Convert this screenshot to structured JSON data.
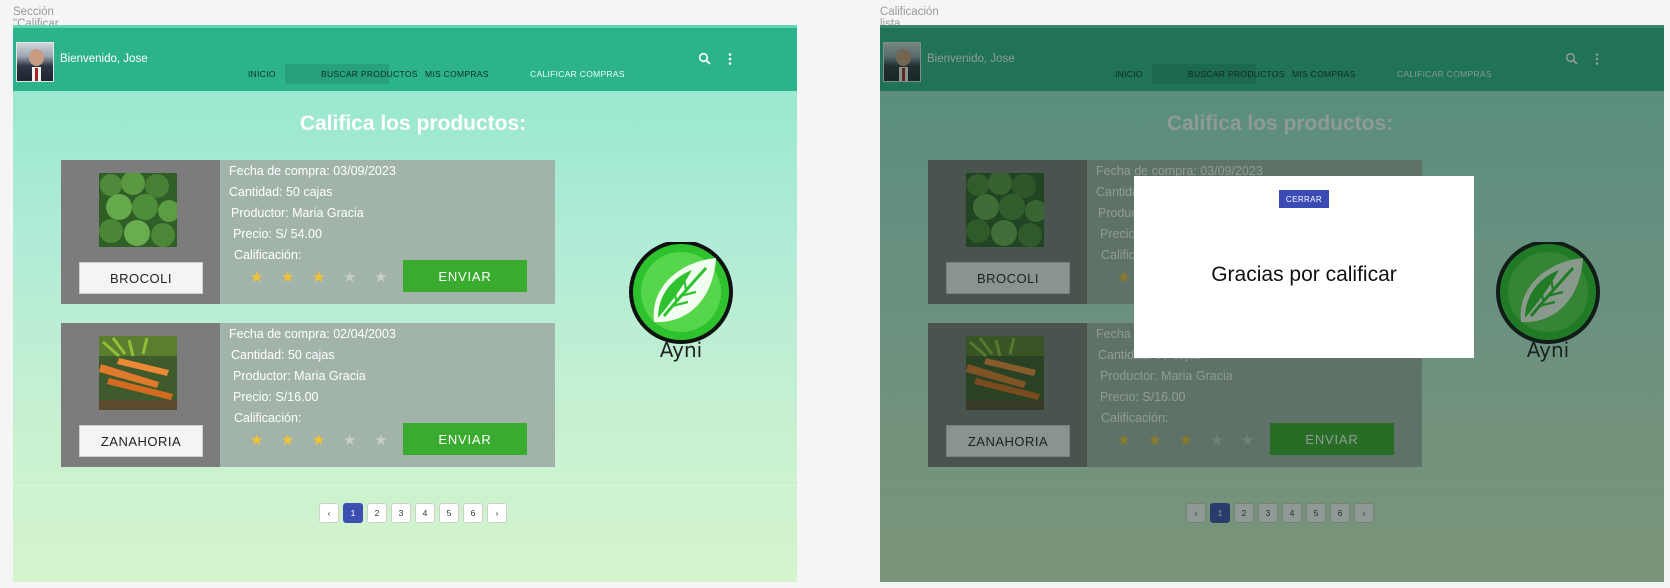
{
  "frames": [
    {
      "label": "Sección \"Calificar compras\""
    },
    {
      "label": "Calificación lista"
    }
  ],
  "appbar": {
    "welcome": "Bienvenido, Jose",
    "nav": [
      "INICIO",
      "BUSCAR PRODUCTOS",
      "MIS COMPRAS",
      "CALIFICAR COMPRAS"
    ],
    "icons": [
      "search-icon",
      "more-vert-icon"
    ]
  },
  "heading": "Califica los productos:",
  "products": [
    {
      "name": "BROCOLI",
      "fecha": "Fecha de compra: 03/09/2023",
      "cantidad": "Cantidad: 50 cajas",
      "productor": "Productor: Maria Gracia",
      "precio": "Precio: S/ 54.00",
      "calificacion_label": "Calificación:",
      "rating": 3,
      "max_rating": 5,
      "send_label": "ENVIAR"
    },
    {
      "name": "ZANAHORIA",
      "fecha": "Fecha de compra: 02/04/2003",
      "cantidad": "Cantidad: 50 cajas",
      "productor": "Productor: Maria Gracia",
      "precio": "Precio: S/16.00",
      "calificacion_label": "Calificación:",
      "rating": 3,
      "max_rating": 5,
      "send_label": "ENVIAR"
    }
  ],
  "pagination": {
    "prev": "‹",
    "pages": [
      "1",
      "2",
      "3",
      "4",
      "5",
      "6"
    ],
    "next": "›",
    "current": "1"
  },
  "logo_text": "Ayni",
  "modal": {
    "close_label": "CERRAR",
    "message": "Gracias por calificar"
  },
  "colors": {
    "appbar": "#2db38c",
    "star_on": "#f4c430",
    "star_off": "#c8cfcb",
    "send": "#39ab2e",
    "active_page": "#3d4fb0"
  }
}
